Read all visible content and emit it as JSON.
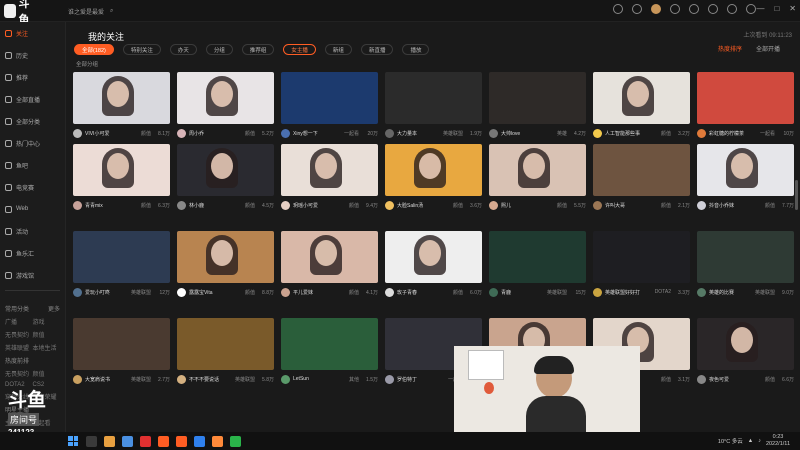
{
  "topbar": {
    "logo_text": "斗鱼",
    "search_text": "谁之爱是最爱"
  },
  "sidebar": {
    "items": [
      {
        "label": "关注",
        "active": true
      },
      {
        "label": "历史"
      },
      {
        "label": "推荐"
      },
      {
        "label": "全部直播"
      },
      {
        "label": "全部分类"
      },
      {
        "label": "热门中心"
      },
      {
        "label": "鱼吧"
      },
      {
        "label": "电竞赛"
      },
      {
        "label": "Web"
      },
      {
        "label": "活动"
      },
      {
        "label": "鱼乐汇"
      },
      {
        "label": "游戏馆"
      }
    ],
    "cat1": {
      "head": "常用分类",
      "more": "更多",
      "items": [
        "广播",
        "游戏",
        "无畏契约",
        "颜值",
        "英雄联盟",
        "本地生活"
      ]
    },
    "cat2": {
      "head": "热度前排",
      "items": [
        "无畏契约",
        "颜值",
        "DOTA2",
        "CS2",
        "穿越火线",
        "王者荣耀"
      ]
    },
    "cat3": {
      "head": "明星主播",
      "items": [
        "主机游戏",
        "一起看"
      ]
    }
  },
  "brand": {
    "big": "斗鱼",
    "sub": "房间号",
    "room": "241123"
  },
  "header": {
    "title": "我的关注",
    "hint": "上次看到 09:11:23",
    "filters": [
      "全部(182)",
      "特别关注",
      "办天",
      "分组",
      "推荐组",
      "女主播",
      "新组",
      "新直播",
      "播放"
    ],
    "sort": [
      "热度排序",
      "全部开播"
    ],
    "manage": "全部分组"
  },
  "cards": [
    {
      "name": "VIVI小可爱",
      "game": "颜值",
      "heat": "8.1万",
      "bg": "#d9d9de",
      "av": "#bbb",
      "kind": "person"
    },
    {
      "name": "周小乔",
      "game": "颜值",
      "heat": "5.2万",
      "bg": "#e8e4e6",
      "av": "#d8b4b8",
      "kind": "person"
    },
    {
      "name": "Xiny想一下",
      "game": "一起看",
      "heat": "20万",
      "bg": "#1c3a6e",
      "av": "#4a6fb0",
      "kind": "banner"
    },
    {
      "name": "大力量本",
      "game": "英雄联盟",
      "heat": "1.9万",
      "bg": "#2b2b2b",
      "av": "#666",
      "kind": "desk"
    },
    {
      "name": "大帅love",
      "game": "英雄",
      "heat": "4.2万",
      "bg": "#2e2a28",
      "av": "#777",
      "kind": "room"
    },
    {
      "name": "人工智能那些事",
      "game": "颜值",
      "heat": "3.2万",
      "bg": "#e6e2dc",
      "av": "#f2c94c",
      "kind": "person"
    },
    {
      "name": "彩虹糖的柠檬茶",
      "game": "一起看",
      "heat": "10万",
      "bg": "#d04a3e",
      "av": "#e07a3a",
      "kind": "banner"
    },
    {
      "name": "青青mix",
      "game": "颜值",
      "heat": "6.3万",
      "bg": "#ecdcd6",
      "av": "#c7a29a",
      "kind": "person"
    },
    {
      "name": "林小鹿",
      "game": "颜值",
      "heat": "4.5万",
      "bg": "#2a2a30",
      "av": "#888",
      "kind": "person"
    },
    {
      "name": "玥瑶小可爱",
      "game": "颜值",
      "heat": "9.4万",
      "bg": "#e9dfd8",
      "av": "#e5cfc3",
      "kind": "person"
    },
    {
      "name": "大脸Salin汤",
      "game": "颜值",
      "heat": "3.6万",
      "bg": "#e8a840",
      "av": "#f0c060",
      "kind": "person"
    },
    {
      "name": "熙儿",
      "game": "颜值",
      "heat": "5.5万",
      "bg": "#d9c2b4",
      "av": "#d6a98f",
      "kind": "person"
    },
    {
      "name": "许叫大哥",
      "game": "颜值",
      "heat": "2.1万",
      "bg": "#6e5440",
      "av": "#9b7755",
      "kind": "room"
    },
    {
      "name": "抖音小乔妹",
      "game": "颜值",
      "heat": "7.7万",
      "bg": "#e6e6ea",
      "av": "#cfcfd8",
      "kind": "person"
    },
    {
      "name": "爱玩小叮咚",
      "game": "英雄联盟",
      "heat": "12万",
      "bg": "#2d3b52",
      "av": "#52708f",
      "kind": "game"
    },
    {
      "name": "露露宝Vita",
      "game": "颜值",
      "heat": "8.8万",
      "bg": "#b88450",
      "av": "#fff",
      "kind": "person"
    },
    {
      "name": "平儿爱妹",
      "game": "颜值",
      "heat": "4.1万",
      "bg": "#d9b8a8",
      "av": "#caa28f",
      "kind": "person"
    },
    {
      "name": "玫子青春",
      "game": "颜值",
      "heat": "6.0万",
      "bg": "#eeeeee",
      "av": "#ddd",
      "kind": "person"
    },
    {
      "name": "青鹿",
      "game": "英雄联盟",
      "heat": "15万",
      "bg": "#1f3a30",
      "av": "#3f6b56",
      "kind": "game"
    },
    {
      "name": "英雄联盟好好打",
      "game": "DOTA2",
      "heat": "3.3万",
      "bg": "#1e1e22",
      "av": "#c9a440",
      "kind": "dark"
    },
    {
      "name": "英雄的比赛",
      "game": "英雄联盟",
      "heat": "9.0万",
      "bg": "#2e3a34",
      "av": "#567a66",
      "kind": "game"
    },
    {
      "name": "大宽肩说书",
      "game": "英雄联盟",
      "heat": "2.7万",
      "bg": "#4a3a30",
      "av": "#c9a060",
      "kind": "room"
    },
    {
      "name": "不不不要说话",
      "game": "英雄联盟",
      "heat": "5.8万",
      "bg": "#7a5a2a",
      "av": "#d4b080",
      "kind": "game"
    },
    {
      "name": "LetSun",
      "game": "其他",
      "heat": "1.5万",
      "bg": "#2a5e3a",
      "av": "#5a9a6a",
      "kind": "mahjong"
    },
    {
      "name": "罗伯特丁",
      "game": "一起看",
      "heat": "2.9万",
      "bg": "#303038",
      "av": "#9a9aa8",
      "kind": "dark"
    },
    {
      "name": "大白",
      "game": "颜值",
      "heat": "4.4万",
      "bg": "#c9a48e",
      "av": "#d8b8a0",
      "kind": "person"
    },
    {
      "name": "小可爱",
      "game": "颜值",
      "heat": "3.1万",
      "bg": "#e3d6cb",
      "av": "#c8b0a0",
      "kind": "person"
    },
    {
      "name": "夜色可爱",
      "game": "颜值",
      "heat": "6.6万",
      "bg": "#2a2628",
      "av": "#888",
      "kind": "person"
    }
  ],
  "taskbar": {
    "weather": "10°C 多云",
    "time": "0:23",
    "date": "2022/1/11"
  }
}
